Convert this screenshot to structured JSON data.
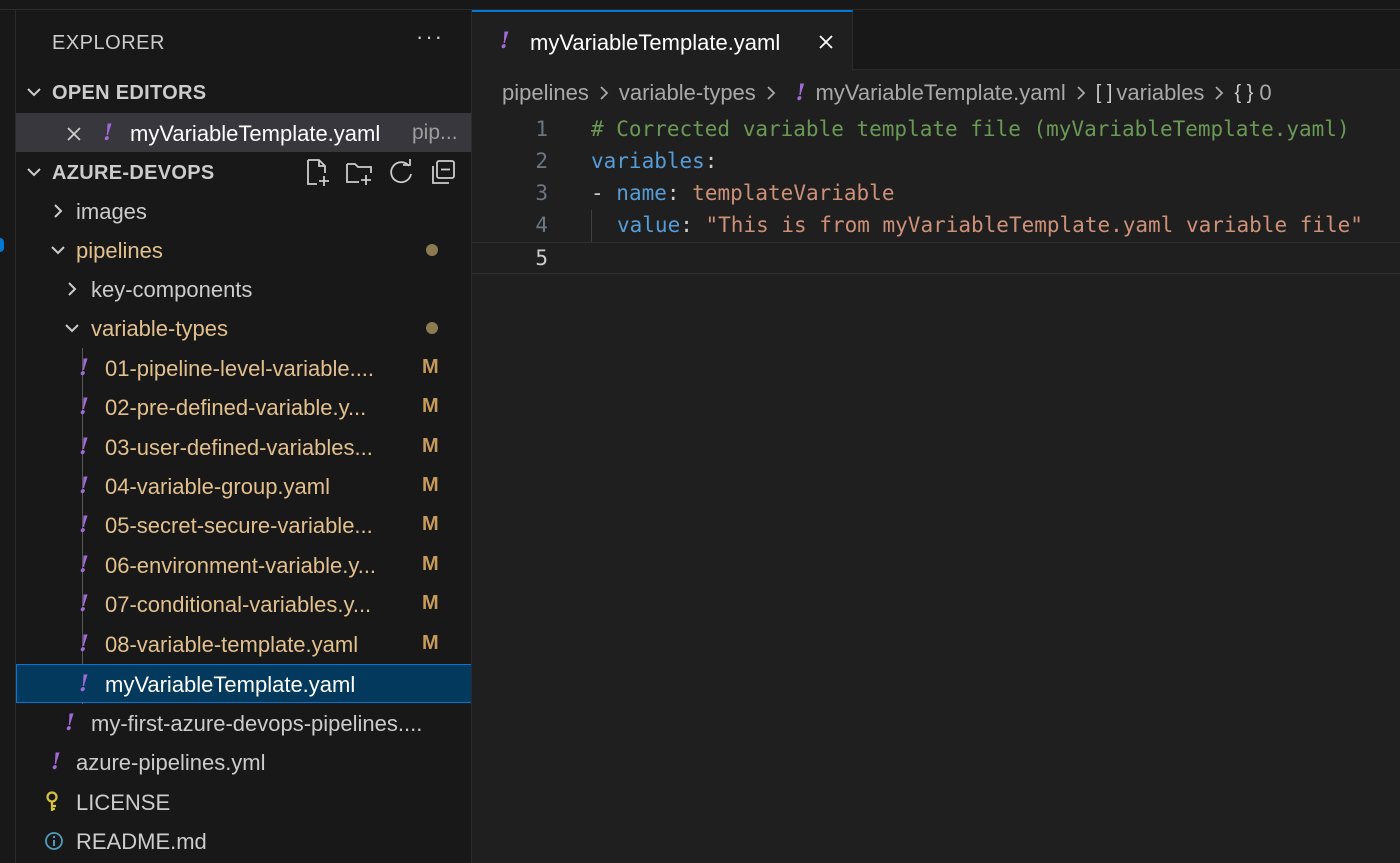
{
  "sidebar": {
    "title": "EXPLORER",
    "more_label": "···",
    "open_editors": {
      "label": "OPEN EDITORS",
      "items": [
        {
          "name": "myVariableTemplate.yaml",
          "description": "pip..."
        }
      ]
    },
    "workspace": {
      "label": "AZURE-DEVOPS",
      "tree": [
        {
          "name": "images",
          "kind": "folder-collapsed"
        },
        {
          "name": "pipelines",
          "kind": "folder-expanded"
        },
        {
          "name": "key-components",
          "kind": "folder-collapsed"
        },
        {
          "name": "variable-types",
          "kind": "folder-expanded"
        },
        {
          "name": "01-pipeline-level-variable....",
          "status": "M"
        },
        {
          "name": "02-pre-defined-variable.y...",
          "status": "M"
        },
        {
          "name": "03-user-defined-variables...",
          "status": "M"
        },
        {
          "name": "04-variable-group.yaml",
          "status": "M"
        },
        {
          "name": "05-secret-secure-variable...",
          "status": "M"
        },
        {
          "name": "06-environment-variable.y...",
          "status": "M"
        },
        {
          "name": "07-conditional-variables.y...",
          "status": "M"
        },
        {
          "name": "08-variable-template.yaml",
          "status": "M"
        },
        {
          "name": "myVariableTemplate.yaml",
          "selected": true
        },
        {
          "name": "my-first-azure-devops-pipelines...."
        },
        {
          "name": "azure-pipelines.yml"
        },
        {
          "name": "LICENSE",
          "icon": "key-icon"
        },
        {
          "name": "README.md",
          "icon": "info-icon"
        }
      ]
    },
    "colors": {
      "modified": "#e2c08d",
      "yaml_icon": "#a26ad6",
      "accent": "#0078d4"
    }
  },
  "editor": {
    "tab": {
      "label": "myVariableTemplate.yaml"
    },
    "breadcrumb": {
      "folder1": "pipelines",
      "folder2": "variable-types",
      "file": "myVariableTemplate.yaml",
      "symbol1_icon": "[ ]",
      "symbol1": "variables",
      "symbol2_icon": "{ }",
      "symbol2": "0"
    },
    "lines": [
      {
        "number": "1",
        "comment": "# Corrected variable template file (myVariableTemplate.yaml)"
      },
      {
        "number": "2",
        "key": "variables",
        "punc": ":"
      },
      {
        "number": "3",
        "dash": "- ",
        "key": "name",
        "punc": ": ",
        "value": "templateVariable"
      },
      {
        "number": "4",
        "key": "value",
        "punc": ": ",
        "value": "\"This is from myVariableTemplate.yaml variable file\""
      },
      {
        "number": "5"
      }
    ]
  }
}
